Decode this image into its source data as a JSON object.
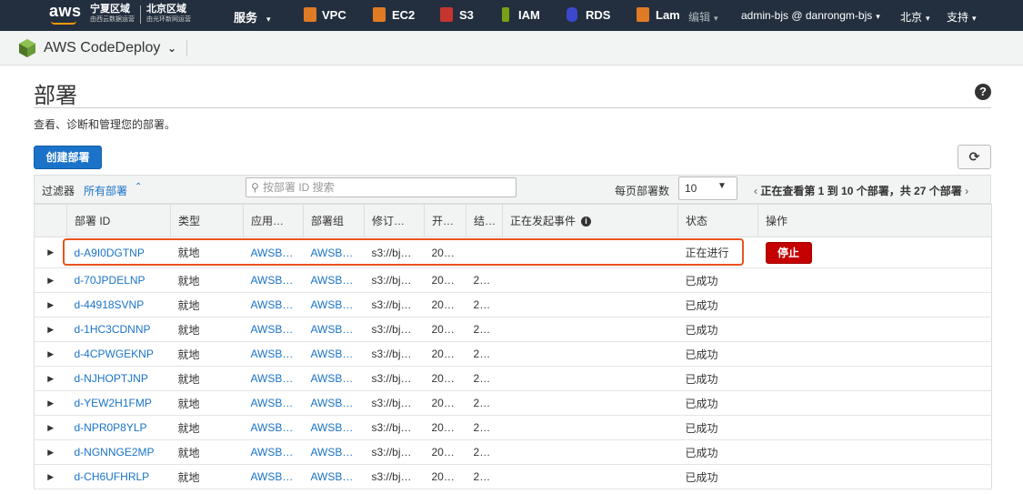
{
  "topbar": {
    "logo": "aws",
    "regions": [
      {
        "name": "宁夏区域",
        "operator": "由西云数据运营"
      },
      {
        "name": "北京区域",
        "operator": "由光环新网运营"
      }
    ],
    "nav": [
      {
        "label": "服务",
        "caret": "▾"
      },
      {
        "label": "VPC",
        "icon": "vpc-icon",
        "color": "#e07b25"
      },
      {
        "label": "EC2",
        "icon": "ec2-icon",
        "color": "#e07b25"
      },
      {
        "label": "S3",
        "icon": "s3-icon",
        "color": "#c7352f"
      },
      {
        "label": "IAM",
        "icon": "iam-icon",
        "color": "#7aa116"
      },
      {
        "label": "RDS",
        "icon": "rds-icon",
        "color": "#3b48cc"
      },
      {
        "label": "Lam",
        "icon": "lambda-icon",
        "color": "#e07b25"
      }
    ],
    "edit_label": "编辑",
    "user": "admin-bjs @ danrongm-bjs",
    "region": "北京",
    "support": "支持"
  },
  "service": {
    "title": "AWS CodeDeploy"
  },
  "page": {
    "title": "部署",
    "description": "查看、诊断和管理您的部署。",
    "create_button": "创建部署",
    "refresh_icon": "refresh-icon"
  },
  "filter": {
    "label": "过滤器",
    "value": "所有部署",
    "search_placeholder": "按部署 ID 搜索",
    "per_page_label": "每页部署数",
    "per_page_value": "10",
    "pager_prev": "‹",
    "pager_text": "正在查看第 1 到 10 个部署，共 27 个部署",
    "pager_next": "›"
  },
  "table": {
    "columns": [
      "部署 ID",
      "类型",
      "应用…",
      "部署组",
      "修订…",
      "开…",
      "结…",
      "正在发起事件",
      "状态",
      "操作"
    ],
    "rows": [
      {
        "id": "d-A9I0DGTNP",
        "type": "就地",
        "app": "AWSB…",
        "group": "AWSB…",
        "revision": "s3://bj…",
        "start": "20…",
        "end": "",
        "status": "正在进行",
        "action": "停止"
      },
      {
        "id": "d-70JPDELNP",
        "type": "就地",
        "app": "AWSB…",
        "group": "AWSB…",
        "revision": "s3://bj…",
        "start": "20…",
        "end": "20…",
        "status": "已成功",
        "action": ""
      },
      {
        "id": "d-44918SVNP",
        "type": "就地",
        "app": "AWSB…",
        "group": "AWSB…",
        "revision": "s3://bj…",
        "start": "20…",
        "end": "20…",
        "status": "已成功",
        "action": ""
      },
      {
        "id": "d-1HC3CDNNP",
        "type": "就地",
        "app": "AWSB…",
        "group": "AWSB…",
        "revision": "s3://bj…",
        "start": "20…",
        "end": "20…",
        "status": "已成功",
        "action": ""
      },
      {
        "id": "d-4CPWGEKNP",
        "type": "就地",
        "app": "AWSB…",
        "group": "AWSB…",
        "revision": "s3://bj…",
        "start": "20…",
        "end": "20…",
        "status": "已成功",
        "action": ""
      },
      {
        "id": "d-NJHOPTJNP",
        "type": "就地",
        "app": "AWSB…",
        "group": "AWSB…",
        "revision": "s3://bj…",
        "start": "20…",
        "end": "20…",
        "status": "已成功",
        "action": ""
      },
      {
        "id": "d-YEW2H1FMP",
        "type": "就地",
        "app": "AWSB…",
        "group": "AWSB…",
        "revision": "s3://bj…",
        "start": "20…",
        "end": "20…",
        "status": "已成功",
        "action": ""
      },
      {
        "id": "d-NPR0P8YLP",
        "type": "就地",
        "app": "AWSB…",
        "group": "AWSB…",
        "revision": "s3://bj…",
        "start": "20…",
        "end": "20…",
        "status": "已成功",
        "action": ""
      },
      {
        "id": "d-NGNNGE2MP",
        "type": "就地",
        "app": "AWSB…",
        "group": "AWSB…",
        "revision": "s3://bj…",
        "start": "20…",
        "end": "20…",
        "status": "已成功",
        "action": ""
      },
      {
        "id": "d-CH6UFHRLP",
        "type": "就地",
        "app": "AWSB…",
        "group": "AWSB…",
        "revision": "s3://bj…",
        "start": "20…",
        "end": "20…",
        "status": "已成功",
        "action": ""
      }
    ]
  },
  "colors": {
    "nav_bg": "#232f3e",
    "link": "#1a73c8",
    "success": "#1d8102",
    "stop_button": "#c40000",
    "highlight": "#e8541f"
  }
}
